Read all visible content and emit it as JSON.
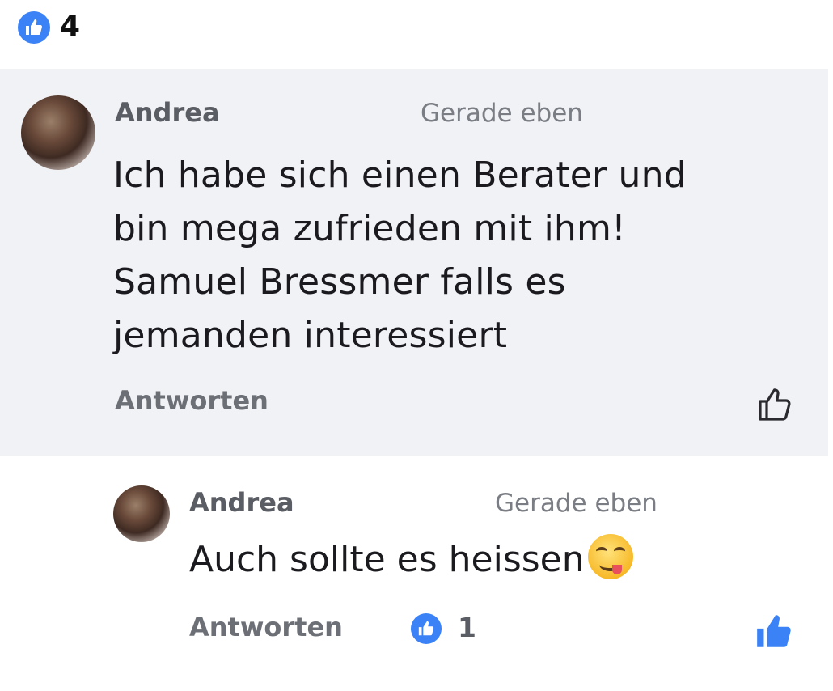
{
  "header": {
    "like_count": "4"
  },
  "comment": {
    "author": "Andrea",
    "time": "Gerade eben",
    "lines": [
      "Ich habe sich einen Berater und",
      "bin mega zufrieden mit ihm!",
      "Samuel Bressmer falls es",
      "jemanden interessiert"
    ],
    "reply_label": "Antworten"
  },
  "reply": {
    "author": "Andrea",
    "time": "Gerade eben",
    "text": "Auch sollte es heissen",
    "reply_label": "Antworten",
    "like_count": "1"
  },
  "colors": {
    "accent": "#3b82f6",
    "panel": "#f1f2f6"
  },
  "icons": [
    "like-badge-icon",
    "thumbs-up-outline-icon",
    "thumbs-up-filled-icon",
    "tongue-emoji-icon"
  ]
}
